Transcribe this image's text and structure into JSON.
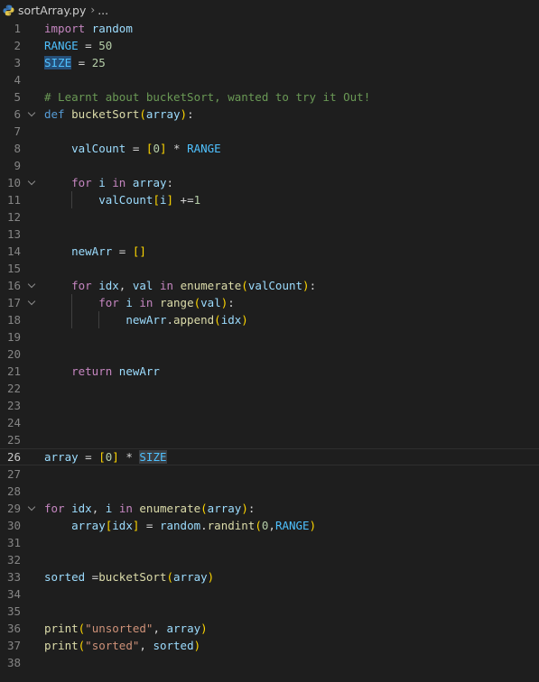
{
  "breadcrumb": {
    "file_icon": "python-file-icon",
    "file_name": "sortArray.py",
    "separator": "›",
    "more": "..."
  },
  "colors": {
    "editor_background": "#1e1e1e",
    "keyword": "#c586c0",
    "def_keyword": "#569cd6",
    "function": "#dcdcaa",
    "variable": "#9cdcfe",
    "constant": "#4fc1ff",
    "number": "#b5cea8",
    "string": "#ce9178",
    "comment": "#6a9955",
    "bracket_level_1": "#ffd700",
    "bracket_level_2": "#da70d6",
    "line_number": "#858585",
    "selection": "#264f78"
  },
  "editor": {
    "current_line": 26,
    "lines": [
      {
        "n": "1",
        "fold": false,
        "tokens": [
          {
            "t": "import",
            "c": "kw"
          },
          {
            "t": " ",
            "c": "id"
          },
          {
            "t": "random",
            "c": "var"
          }
        ]
      },
      {
        "n": "2",
        "fold": false,
        "tokens": [
          {
            "t": "RANGE",
            "c": "const"
          },
          {
            "t": " = ",
            "c": "op"
          },
          {
            "t": "50",
            "c": "num"
          }
        ]
      },
      {
        "n": "3",
        "fold": false,
        "tokens": [
          {
            "t": "SIZE",
            "c": "const",
            "hl": "sel"
          },
          {
            "t": " = ",
            "c": "op"
          },
          {
            "t": "25",
            "c": "num"
          }
        ]
      },
      {
        "n": "4",
        "fold": false,
        "tokens": []
      },
      {
        "n": "5",
        "fold": false,
        "tokens": [
          {
            "t": "# Learnt about bucketSort, wanted to try it Out!",
            "c": "com"
          }
        ]
      },
      {
        "n": "6",
        "fold": true,
        "tokens": [
          {
            "t": "def",
            "c": "def"
          },
          {
            "t": " ",
            "c": "id"
          },
          {
            "t": "bucketSort",
            "c": "fn"
          },
          {
            "t": "(",
            "c": "br1"
          },
          {
            "t": "array",
            "c": "var"
          },
          {
            "t": ")",
            "c": "br1"
          },
          {
            "t": ":",
            "c": "op"
          }
        ]
      },
      {
        "n": "7",
        "fold": false,
        "tokens": []
      },
      {
        "n": "8",
        "fold": false,
        "tokens": [
          {
            "t": "    ",
            "c": "id"
          },
          {
            "t": "valCount",
            "c": "var"
          },
          {
            "t": " = ",
            "c": "op"
          },
          {
            "t": "[",
            "c": "br1"
          },
          {
            "t": "0",
            "c": "num"
          },
          {
            "t": "]",
            "c": "br1"
          },
          {
            "t": " * ",
            "c": "op"
          },
          {
            "t": "RANGE",
            "c": "const"
          }
        ]
      },
      {
        "n": "9",
        "fold": false,
        "tokens": []
      },
      {
        "n": "10",
        "fold": true,
        "tokens": [
          {
            "t": "    ",
            "c": "id"
          },
          {
            "t": "for",
            "c": "kw"
          },
          {
            "t": " ",
            "c": "id"
          },
          {
            "t": "i",
            "c": "var"
          },
          {
            "t": " ",
            "c": "id"
          },
          {
            "t": "in",
            "c": "kw"
          },
          {
            "t": " ",
            "c": "id"
          },
          {
            "t": "array",
            "c": "var"
          },
          {
            "t": ":",
            "c": "op"
          }
        ]
      },
      {
        "n": "11",
        "fold": false,
        "tokens": [
          {
            "t": "        ",
            "c": "id"
          },
          {
            "t": "valCount",
            "c": "var"
          },
          {
            "t": "[",
            "c": "br1"
          },
          {
            "t": "i",
            "c": "var"
          },
          {
            "t": "]",
            "c": "br1"
          },
          {
            "t": " +=",
            "c": "op"
          },
          {
            "t": "1",
            "c": "num"
          }
        ]
      },
      {
        "n": "12",
        "fold": false,
        "tokens": []
      },
      {
        "n": "13",
        "fold": false,
        "tokens": []
      },
      {
        "n": "14",
        "fold": false,
        "tokens": [
          {
            "t": "    ",
            "c": "id"
          },
          {
            "t": "newArr",
            "c": "var"
          },
          {
            "t": " = ",
            "c": "op"
          },
          {
            "t": "[]",
            "c": "br1"
          }
        ]
      },
      {
        "n": "15",
        "fold": false,
        "tokens": []
      },
      {
        "n": "16",
        "fold": true,
        "tokens": [
          {
            "t": "    ",
            "c": "id"
          },
          {
            "t": "for",
            "c": "kw"
          },
          {
            "t": " ",
            "c": "id"
          },
          {
            "t": "idx",
            "c": "var"
          },
          {
            "t": ", ",
            "c": "op"
          },
          {
            "t": "val",
            "c": "var"
          },
          {
            "t": " ",
            "c": "id"
          },
          {
            "t": "in",
            "c": "kw"
          },
          {
            "t": " ",
            "c": "id"
          },
          {
            "t": "enumerate",
            "c": "fn"
          },
          {
            "t": "(",
            "c": "br1"
          },
          {
            "t": "valCount",
            "c": "var"
          },
          {
            "t": ")",
            "c": "br1"
          },
          {
            "t": ":",
            "c": "op"
          }
        ]
      },
      {
        "n": "17",
        "fold": true,
        "tokens": [
          {
            "t": "        ",
            "c": "id"
          },
          {
            "t": "for",
            "c": "kw"
          },
          {
            "t": " ",
            "c": "id"
          },
          {
            "t": "i",
            "c": "var"
          },
          {
            "t": " ",
            "c": "id"
          },
          {
            "t": "in",
            "c": "kw"
          },
          {
            "t": " ",
            "c": "id"
          },
          {
            "t": "range",
            "c": "fn"
          },
          {
            "t": "(",
            "c": "br1"
          },
          {
            "t": "val",
            "c": "var"
          },
          {
            "t": ")",
            "c": "br1"
          },
          {
            "t": ":",
            "c": "op"
          }
        ]
      },
      {
        "n": "18",
        "fold": false,
        "tokens": [
          {
            "t": "            ",
            "c": "id"
          },
          {
            "t": "newArr",
            "c": "var"
          },
          {
            "t": ".",
            "c": "op"
          },
          {
            "t": "append",
            "c": "fn"
          },
          {
            "t": "(",
            "c": "br1"
          },
          {
            "t": "idx",
            "c": "var"
          },
          {
            "t": ")",
            "c": "br1"
          }
        ]
      },
      {
        "n": "19",
        "fold": false,
        "tokens": []
      },
      {
        "n": "20",
        "fold": false,
        "tokens": []
      },
      {
        "n": "21",
        "fold": false,
        "tokens": [
          {
            "t": "    ",
            "c": "id"
          },
          {
            "t": "return",
            "c": "kw"
          },
          {
            "t": " ",
            "c": "id"
          },
          {
            "t": "newArr",
            "c": "var"
          }
        ]
      },
      {
        "n": "22",
        "fold": false,
        "tokens": []
      },
      {
        "n": "23",
        "fold": false,
        "tokens": []
      },
      {
        "n": "24",
        "fold": false,
        "tokens": []
      },
      {
        "n": "25",
        "fold": false,
        "tokens": []
      },
      {
        "n": "26",
        "fold": false,
        "tokens": [
          {
            "t": "array",
            "c": "var"
          },
          {
            "t": " = ",
            "c": "op"
          },
          {
            "t": "[",
            "c": "br1"
          },
          {
            "t": "0",
            "c": "num"
          },
          {
            "t": "]",
            "c": "br1"
          },
          {
            "t": " * ",
            "c": "op"
          },
          {
            "t": "SIZE",
            "c": "const",
            "hl": "occ"
          }
        ]
      },
      {
        "n": "27",
        "fold": false,
        "tokens": []
      },
      {
        "n": "28",
        "fold": false,
        "tokens": []
      },
      {
        "n": "29",
        "fold": true,
        "tokens": [
          {
            "t": "for",
            "c": "kw"
          },
          {
            "t": " ",
            "c": "id"
          },
          {
            "t": "idx",
            "c": "var"
          },
          {
            "t": ", ",
            "c": "op"
          },
          {
            "t": "i",
            "c": "var"
          },
          {
            "t": " ",
            "c": "id"
          },
          {
            "t": "in",
            "c": "kw"
          },
          {
            "t": " ",
            "c": "id"
          },
          {
            "t": "enumerate",
            "c": "fn"
          },
          {
            "t": "(",
            "c": "br1"
          },
          {
            "t": "array",
            "c": "var"
          },
          {
            "t": ")",
            "c": "br1"
          },
          {
            "t": ":",
            "c": "op"
          }
        ]
      },
      {
        "n": "30",
        "fold": false,
        "tokens": [
          {
            "t": "    ",
            "c": "id"
          },
          {
            "t": "array",
            "c": "var"
          },
          {
            "t": "[",
            "c": "br1"
          },
          {
            "t": "idx",
            "c": "var"
          },
          {
            "t": "]",
            "c": "br1"
          },
          {
            "t": " = ",
            "c": "op"
          },
          {
            "t": "random",
            "c": "var"
          },
          {
            "t": ".",
            "c": "op"
          },
          {
            "t": "randint",
            "c": "fn"
          },
          {
            "t": "(",
            "c": "br1"
          },
          {
            "t": "0",
            "c": "num"
          },
          {
            "t": ",",
            "c": "op"
          },
          {
            "t": "RANGE",
            "c": "const"
          },
          {
            "t": ")",
            "c": "br1"
          }
        ]
      },
      {
        "n": "31",
        "fold": false,
        "tokens": []
      },
      {
        "n": "32",
        "fold": false,
        "tokens": []
      },
      {
        "n": "33",
        "fold": false,
        "tokens": [
          {
            "t": "sorted",
            "c": "var"
          },
          {
            "t": " =",
            "c": "op"
          },
          {
            "t": "bucketSort",
            "c": "fn"
          },
          {
            "t": "(",
            "c": "br1"
          },
          {
            "t": "array",
            "c": "var"
          },
          {
            "t": ")",
            "c": "br1"
          }
        ]
      },
      {
        "n": "34",
        "fold": false,
        "tokens": []
      },
      {
        "n": "35",
        "fold": false,
        "tokens": []
      },
      {
        "n": "36",
        "fold": false,
        "tokens": [
          {
            "t": "print",
            "c": "fn"
          },
          {
            "t": "(",
            "c": "br1"
          },
          {
            "t": "\"unsorted\"",
            "c": "str"
          },
          {
            "t": ", ",
            "c": "op"
          },
          {
            "t": "array",
            "c": "var"
          },
          {
            "t": ")",
            "c": "br1"
          }
        ]
      },
      {
        "n": "37",
        "fold": false,
        "tokens": [
          {
            "t": "print",
            "c": "fn"
          },
          {
            "t": "(",
            "c": "br1"
          },
          {
            "t": "\"sorted\"",
            "c": "str"
          },
          {
            "t": ", ",
            "c": "op"
          },
          {
            "t": "sorted",
            "c": "var"
          },
          {
            "t": ")",
            "c": "br1"
          }
        ]
      },
      {
        "n": "38",
        "fold": false,
        "tokens": []
      }
    ]
  }
}
